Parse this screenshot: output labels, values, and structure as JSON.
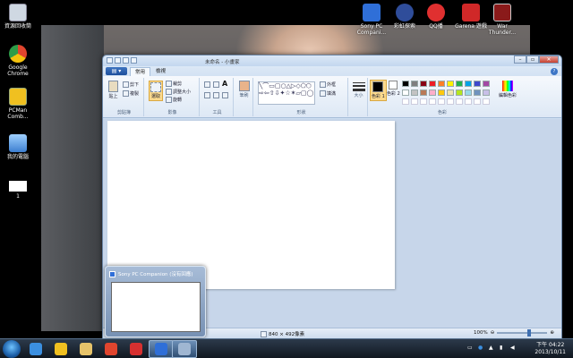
{
  "desktop": {
    "icons": [
      {
        "label": "資源回收筒",
        "name": "recycle-bin-icon",
        "color": "#cfd8e2"
      },
      {
        "label": "Google Chrome",
        "name": "chrome-icon",
        "color": "#e0452e"
      },
      {
        "label": "PCMan Comb...",
        "name": "pcman-icon",
        "color": "#f0c020"
      },
      {
        "label": "我的電腦",
        "name": "my-computer-icon",
        "color": "#5fa0e8"
      },
      {
        "label": "1",
        "name": "file-icon",
        "color": "#ffffff"
      }
    ],
    "top_icons": [
      {
        "label": "Sony PC Compani...",
        "name": "sony-pc-companion-icon",
        "color": "#2f6fd8"
      },
      {
        "label": "彩虹探索",
        "name": "search-app-icon",
        "color": "#2f4d9a"
      },
      {
        "label": "QQ播",
        "name": "qq-player-icon",
        "color": "#e03030"
      },
      {
        "label": "Garena 遊戲",
        "name": "garena-icon",
        "color": "#d02828"
      },
      {
        "label": "War Thunder...",
        "name": "war-thunder-icon",
        "color": "#8a1a1a"
      }
    ]
  },
  "window": {
    "title": "未命名 - 小畫家",
    "file_button": "▤ ▾",
    "tabs": [
      "常用",
      "檢視"
    ],
    "min": "–",
    "max": "▫",
    "close": "✕",
    "help": "?"
  },
  "ribbon": {
    "clipboard": {
      "label": "剪貼簿",
      "paste": "貼上",
      "cut": "剪下",
      "copy": "複製"
    },
    "image": {
      "label": "影像",
      "select": "選取",
      "crop": "裁剪",
      "resize": "調整大小",
      "rotate": "旋轉"
    },
    "tools": {
      "label": "工具"
    },
    "brushes": {
      "label": "筆刷"
    },
    "shapes": {
      "label": "形狀",
      "outline": "外框",
      "fill": "填滿"
    },
    "size": {
      "label": "大小"
    },
    "colors": {
      "label": "色彩",
      "color1": "色彩 1",
      "color2": "色彩 2",
      "edit": "編輯色彩"
    }
  },
  "palette": [
    "#000000",
    "#7f7f7f",
    "#880015",
    "#ed1c24",
    "#ff7f27",
    "#fff200",
    "#22b14c",
    "#00a2e8",
    "#3f48cc",
    "#a349a4",
    "#ffffff",
    "#c3c3c3",
    "#b97a57",
    "#ffaec9",
    "#ffc90e",
    "#efe4b0",
    "#b5e61d",
    "#99d9ea",
    "#7092be",
    "#c8bfe7"
  ],
  "status": {
    "dimensions": "840 × 492像素",
    "zoom": "100%"
  },
  "taskbar": {
    "items": [
      {
        "name": "internet-explorer-icon",
        "color": "#3b8fe0"
      },
      {
        "name": "pcman-taskbar-icon",
        "color": "#f0c020"
      },
      {
        "name": "explorer-icon",
        "color": "#e6c36a"
      },
      {
        "name": "chrome-taskbar-icon",
        "color": "#e0452e"
      },
      {
        "name": "qq-taskbar-icon",
        "color": "#d63030"
      },
      {
        "name": "sony-taskbar-icon",
        "color": "#2f6fd8"
      },
      {
        "name": "paint-taskbar-icon",
        "color": "#9fb6d2"
      }
    ],
    "time": "下午 04:22",
    "date": "2013/10/11"
  },
  "thumbnail": {
    "title": "Sony PC Companion (沒有回應)"
  }
}
